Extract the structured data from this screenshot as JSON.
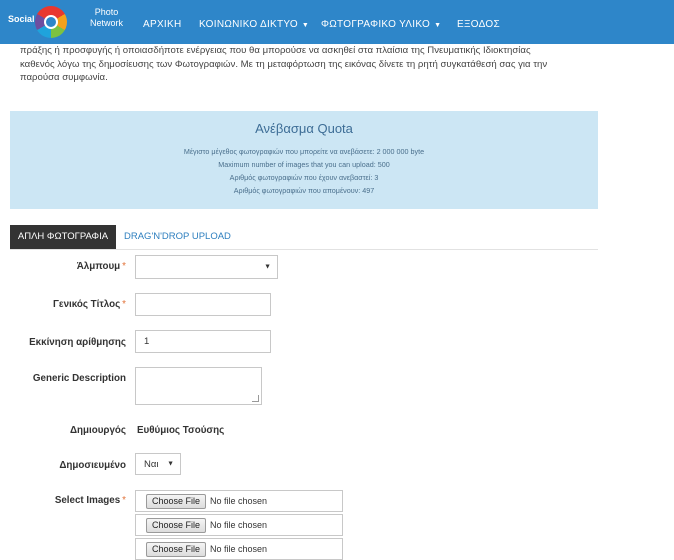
{
  "nav": {
    "brand_left": "Social",
    "brand_right_line1": "Photo",
    "brand_right_line2": "Network",
    "items": [
      {
        "label": "ΑΡΧΙΚΗ",
        "dropdown": false
      },
      {
        "label": "ΚΟΙΝΩΝΙΚΟ ΔΙΚΤΥΟ",
        "dropdown": true
      },
      {
        "label": "ΦΩΤΟΓΡΑΦΙΚΟ ΥΛΙΚΟ",
        "dropdown": true
      },
      {
        "label": "ΕΞΟΔΟΣ",
        "dropdown": false
      }
    ],
    "caret": "▼"
  },
  "legal_text": {
    "line1": "πράξης ή προσφυγής ή οποιασδήποτε ενέργειας που θα μπορούσε να ασκηθεί στα πλαίσια της Πνευματικής Ιδιοκτησίας",
    "line2": "καθενός λόγω της δημοσίευσης των Φωτογραφιών. Με τη μεταφόρτωση της εικόνας δίνετε τη ρητή συγκατάθεσή σας για την",
    "line3": "παρούσα συμφωνία."
  },
  "quota": {
    "title": "Ανέβασμα Quota",
    "lines": [
      "Μέγιστο μέγεθος φωτογραφιών που μπορείτε να ανεβάσετε: 2 000 000 byte",
      "Maximum number of images that you can upload: 500",
      "Αριθμός φωτογραφιών που έχουν ανεβαστεί: 3",
      "Αριθμός φωτογραφιών που απομένουν: 497"
    ]
  },
  "tabs": {
    "active": "ΑΠΛΗ ΦΩΤΟΓΡΑΦΙΑ",
    "other": "DRAG'N'DROP UPLOAD"
  },
  "form": {
    "required_mark": "*",
    "album_label": "Άλμπουμ",
    "album_value": "",
    "title_label": "Γενικός Τίτλος",
    "title_value": "",
    "numbering_label": "Εκκίνηση αρίθμησης",
    "numbering_value": "1",
    "description_label": "Generic Description",
    "description_value": "",
    "creator_label": "Δημιουργός",
    "creator_value": "Ευθύμιος Τσούσης",
    "published_label": "Δημοσιευμένο",
    "published_value": "Ναι",
    "images_label": "Select Images",
    "file_button": "Choose File",
    "file_status": "No file chosen"
  },
  "colors": {
    "navbar": "#2e86c9",
    "quota_bg": "#cce6f4",
    "active_tab": "#333333",
    "required": "#e2733a",
    "link": "#2e7fbf"
  }
}
